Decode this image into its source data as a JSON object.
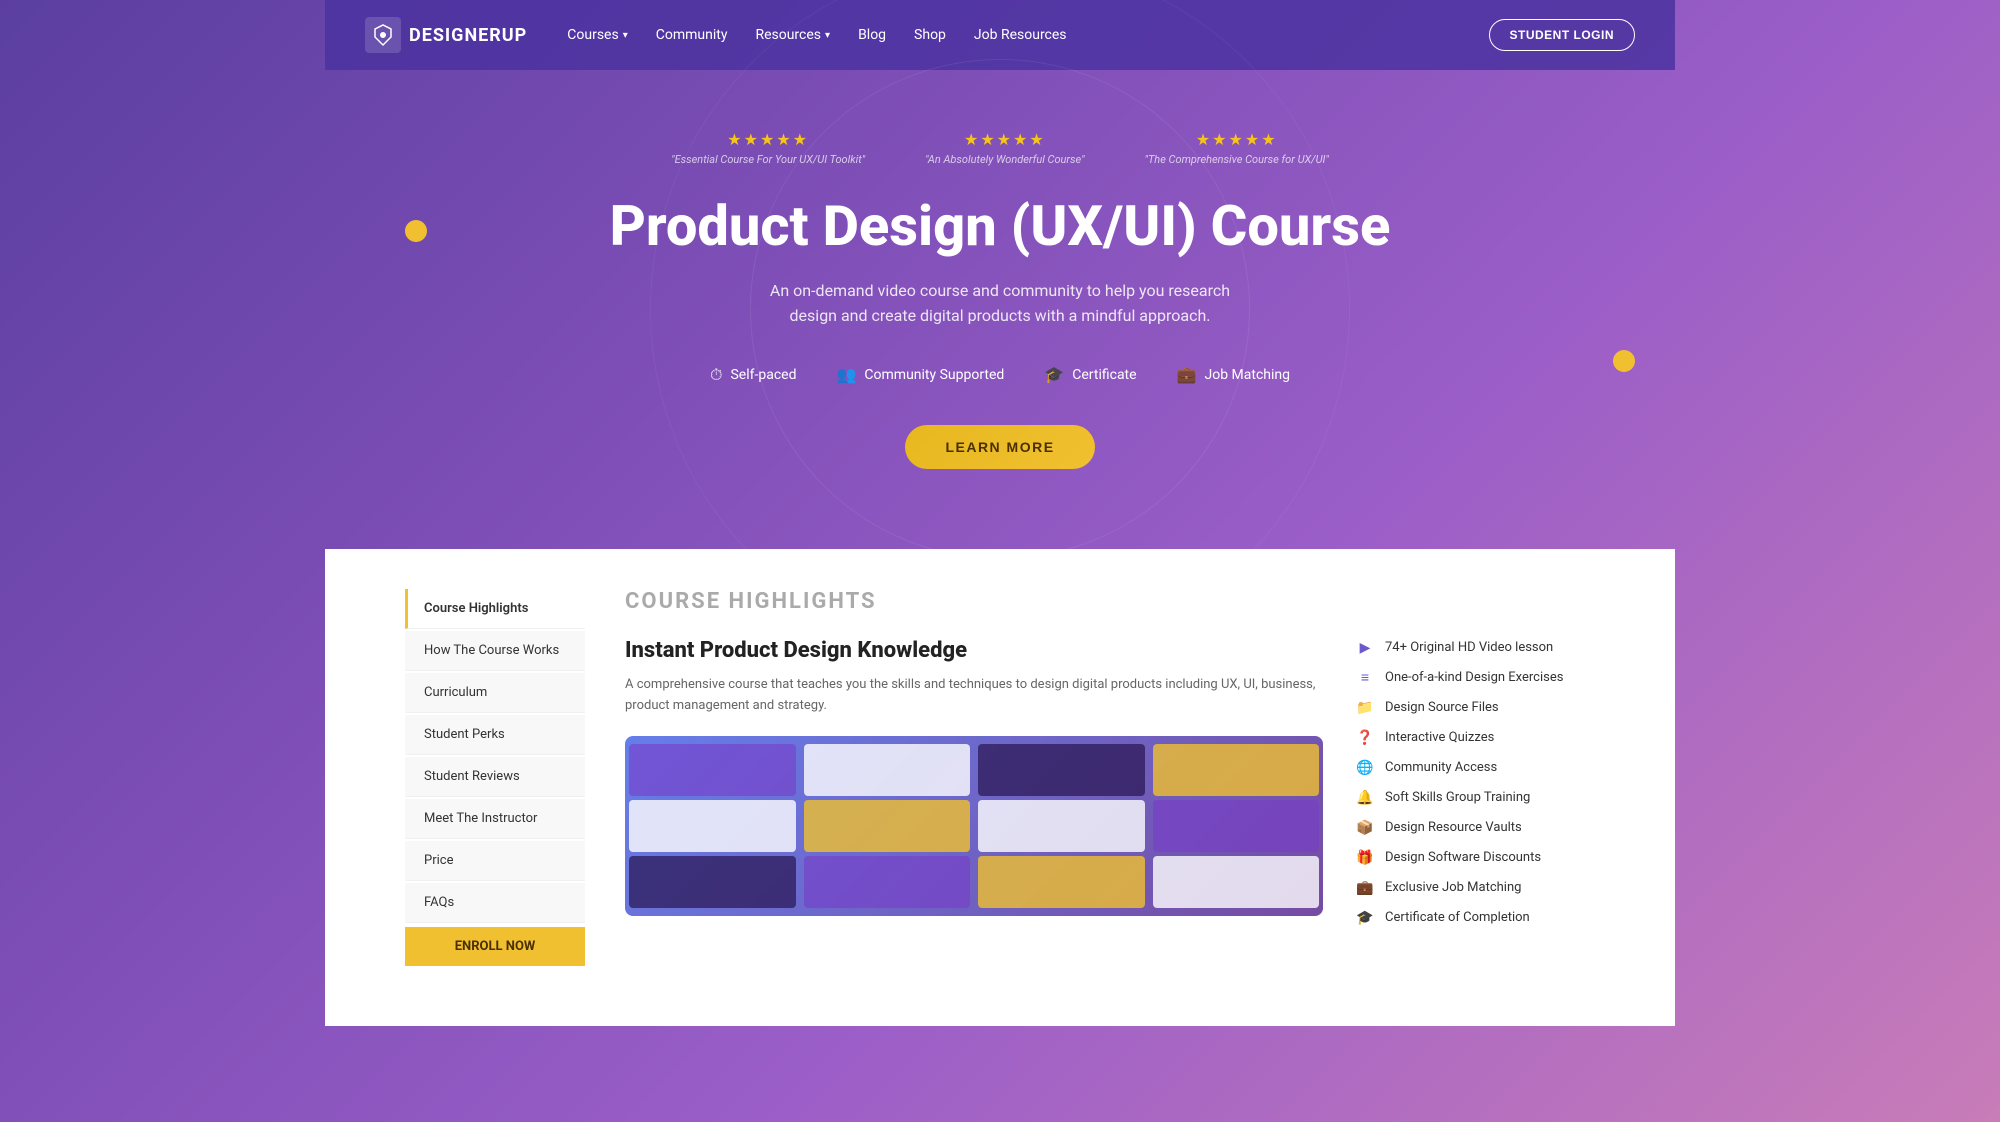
{
  "nav": {
    "logo_text": "DESIGNERUP",
    "links": [
      {
        "label": "Courses",
        "has_dropdown": true
      },
      {
        "label": "Community",
        "has_dropdown": false
      },
      {
        "label": "Resources",
        "has_dropdown": true
      },
      {
        "label": "Blog",
        "has_dropdown": false
      },
      {
        "label": "Shop",
        "has_dropdown": false
      },
      {
        "label": "Job Resources",
        "has_dropdown": false
      }
    ],
    "login_label": "STUDENT LOGIN"
  },
  "hero": {
    "star_reviews": [
      {
        "quote": "\"Essential Course For Your UX/UI Toolkit\""
      },
      {
        "quote": "\"An Absolutely Wonderful Course\""
      },
      {
        "quote": "\"The Comprehensive Course for UX/UI\""
      }
    ],
    "title": "Product Design (UX/UI) Course",
    "subtitle": "An on-demand video course and community to help you research design and create digital products with a mindful approach.",
    "features": [
      {
        "icon": "⏱",
        "label": "Self-paced"
      },
      {
        "icon": "👥",
        "label": "Community Supported"
      },
      {
        "icon": "🎓",
        "label": "Certificate"
      },
      {
        "icon": "💼",
        "label": "Job Matching"
      }
    ],
    "cta_label": "LEARN MORE"
  },
  "sidebar": {
    "items": [
      {
        "label": "Course Highlights",
        "active": true
      },
      {
        "label": "How The Course Works",
        "active": false
      },
      {
        "label": "Curriculum",
        "active": false
      },
      {
        "label": "Student Perks",
        "active": false
      },
      {
        "label": "Student Reviews",
        "active": false
      },
      {
        "label": "Meet The Instructor",
        "active": false
      },
      {
        "label": "Price",
        "active": false
      },
      {
        "label": "FAQs",
        "active": false
      }
    ],
    "cta_label": "ENROLL NOW"
  },
  "highlights": {
    "section_title": "COURSE HIGHLIGHTS",
    "card_title": "Instant Product Design Knowledge",
    "card_desc": "A comprehensive course that teaches you the skills and techniques to design digital products including UX, UI, business, product management and strategy.",
    "features": [
      {
        "icon": "▶",
        "label": "74+ Original HD Video lesson"
      },
      {
        "icon": "≡",
        "label": "One-of-a-kind Design Exercises"
      },
      {
        "icon": "📁",
        "label": "Design Source Files"
      },
      {
        "icon": "❓",
        "label": "Interactive Quizzes"
      },
      {
        "icon": "🌐",
        "label": "Community Access"
      },
      {
        "icon": "🔔",
        "label": "Soft Skills Group Training"
      },
      {
        "icon": "📦",
        "label": "Design Resource Vaults"
      },
      {
        "icon": "🎁",
        "label": "Design Software Discounts"
      },
      {
        "icon": "💼",
        "label": "Exclusive Job Matching"
      },
      {
        "icon": "🎓",
        "label": "Certificate of Completion"
      }
    ]
  }
}
